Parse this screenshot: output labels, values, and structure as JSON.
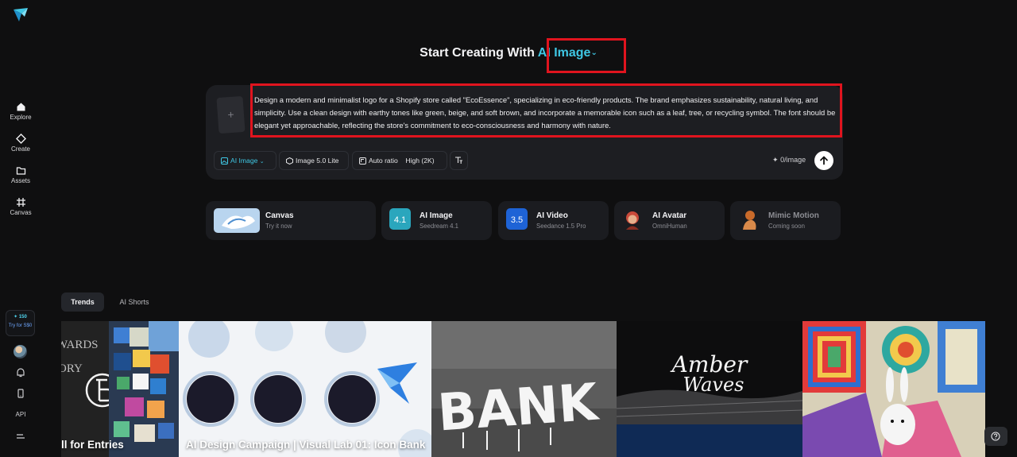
{
  "sidebar": {
    "nav": [
      {
        "label": "Explore",
        "icon": "home-icon"
      },
      {
        "label": "Create",
        "icon": "diamond-icon"
      },
      {
        "label": "Assets",
        "icon": "folder-icon"
      },
      {
        "label": "Canvas",
        "icon": "canvas-icon"
      }
    ],
    "promo": {
      "points": "150",
      "try_label": "Try for S$0"
    },
    "api_label": "API"
  },
  "heading": {
    "prefix": "Start Creating With",
    "mode": "AI Image",
    "chevron": "⌄"
  },
  "prompt": {
    "upload_symbol": "+",
    "text": "Design a modern and minimalist logo for a Shopify store called \"EcoEssence\", specializing in eco-friendly products. The brand emphasizes sustainability, natural living, and simplicity. Use a clean design with earthy tones like green, beige, and soft brown, and incorporate a memorable icon such as a leaf, tree, or recycling symbol. The font should be elegant yet approachable, reflecting the store's commitment to eco-consciousness and harmony with nature.",
    "toolbar": {
      "mode": "AI Image",
      "model": "Image 5.0 Lite",
      "ratio": "Auto ratio",
      "quality": "High (2K)"
    },
    "credits": "0/image"
  },
  "cards": [
    {
      "title": "Canvas",
      "sub": "Try it now"
    },
    {
      "title": "AI Image",
      "sub": "Seedream 4.1",
      "badge": "4.1"
    },
    {
      "title": "AI Video",
      "sub": "Seedance 1.5 Pro",
      "badge": "3.5"
    },
    {
      "title": "AI Avatar",
      "sub": "OmniHuman"
    },
    {
      "title": "Mimic Motion",
      "sub": "Coming soon"
    }
  ],
  "tabs": [
    "Trends",
    "AI Shorts"
  ],
  "gallery": [
    {
      "title": "ll for Entries",
      "art_text": "WARDS",
      "art_text2": "ORY"
    },
    {
      "title": "AI Design Campaign | Visual Lab 01: Icon Bank"
    },
    {
      "title": "",
      "art_text": "BANK"
    },
    {
      "title": "",
      "art_text": "Amber",
      "art_text2": "Waves"
    },
    {
      "title": ""
    }
  ],
  "colors": {
    "accent": "#3fc7e4",
    "highlight": "#e0141e",
    "background": "#0f0f10"
  }
}
